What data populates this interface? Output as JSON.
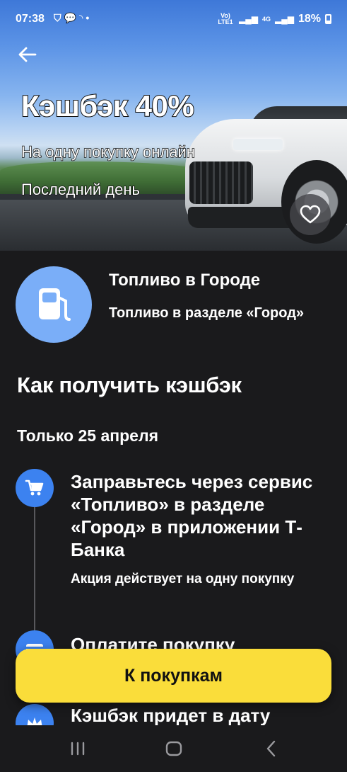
{
  "status_bar": {
    "time": "07:38",
    "notification_icons": [
      "shield-icon",
      "chat-icon",
      "rss-icon",
      "dot-icon"
    ],
    "network_label": "Vo) LTE1",
    "network_type": "4G",
    "battery": "18%"
  },
  "hero": {
    "title": "Кэшбэк 40%",
    "subtitle": "На одну покупку онлайн",
    "deadline": "Последний день"
  },
  "partner": {
    "name": "Топливо в Городе",
    "description": "Топливо в разделе «Город»",
    "logo_color": "#7aaef8"
  },
  "how_to": {
    "title": "Как получить кэшбэк",
    "date_note": "Только 25 апреля",
    "steps": [
      {
        "icon": "cart-icon",
        "title": "Заправьтесь через сервис «Топливо» в разделе «Город» в приложении Т-Банка",
        "note": "Акция действует на одну покупку"
      },
      {
        "icon": "card-icon",
        "title": "Оплатите покупку"
      },
      {
        "icon": "crown-icon",
        "title": "Кэшбэк придет в дату"
      }
    ]
  },
  "cta": {
    "label": "К покупкам"
  },
  "colors": {
    "accent": "#fadd3a",
    "step_icon": "#3c82f0",
    "background": "#1a1a1c"
  }
}
